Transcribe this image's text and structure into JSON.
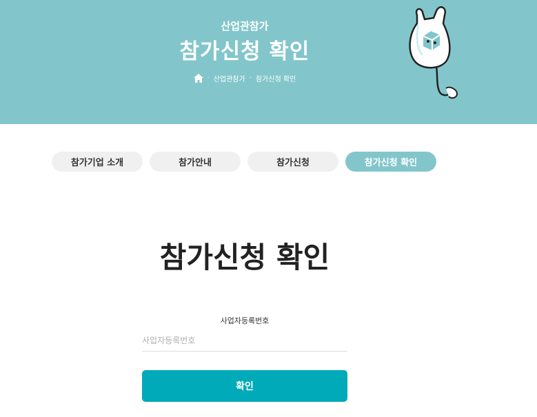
{
  "hero": {
    "subtitle": "산업관참가",
    "title": "참가신청 확인",
    "breadcrumb": {
      "home_icon": "home-icon",
      "items": [
        "산업관참가",
        "참가신청 확인"
      ]
    }
  },
  "tabs": [
    {
      "label": "참가기업 소개",
      "active": false
    },
    {
      "label": "참가안내",
      "active": false
    },
    {
      "label": "참가신청",
      "active": false
    },
    {
      "label": "참가신청 확인",
      "active": true
    }
  ],
  "main": {
    "title": "참가신청 확인",
    "field": {
      "label": "사업자등록번호",
      "placeholder": "사업자등록번호",
      "value": ""
    },
    "confirm_label": "확인"
  },
  "colors": {
    "hero_bg": "#82c6cc",
    "active_tab": "#82c6cc",
    "button": "#00aab8"
  }
}
